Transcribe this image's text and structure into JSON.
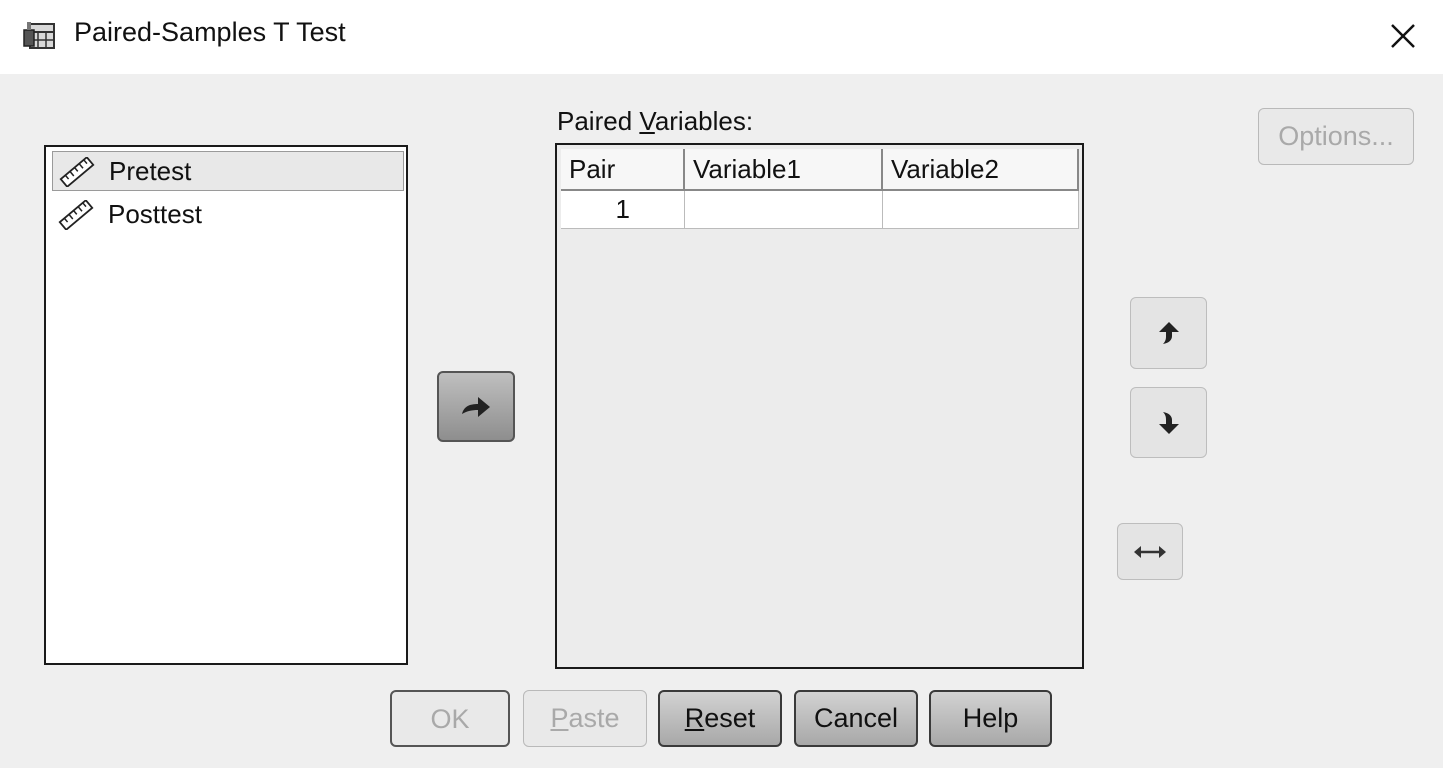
{
  "window": {
    "title": "Paired-Samples T Test",
    "icon": "dialog-table-icon",
    "close_icon": "close-icon"
  },
  "source_variables": {
    "items": [
      {
        "label": "Pretest",
        "icon": "scale-ruler-icon",
        "selected": true
      },
      {
        "label": "Posttest",
        "icon": "scale-ruler-icon",
        "selected": false
      }
    ]
  },
  "transfer_button": {
    "icon": "arrow-right-icon"
  },
  "paired_variables": {
    "label_pre": "Paired ",
    "label_mnemonic": "V",
    "label_post": "ariables:",
    "columns": [
      "Pair",
      "Variable1",
      "Variable2"
    ],
    "rows": [
      {
        "pair": "1",
        "variable1": "",
        "variable2": ""
      }
    ]
  },
  "side_buttons": {
    "options_label": "Options...",
    "move_up_icon": "arrow-up-icon",
    "move_down_icon": "arrow-down-icon",
    "swap_icon": "swap-horizontal-icon"
  },
  "footer_buttons": {
    "ok_label": "OK",
    "paste_mnemonic": "P",
    "paste_rest": "aste",
    "reset_mnemonic": "R",
    "reset_rest": "eset",
    "cancel_label": "Cancel",
    "help_label": "Help"
  }
}
